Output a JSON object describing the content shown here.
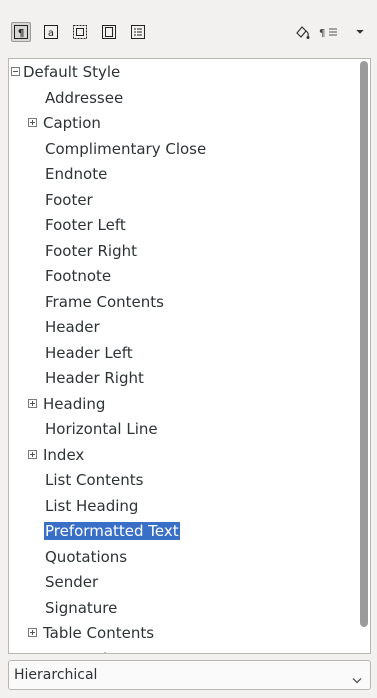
{
  "toolbar": {
    "icons": [
      "paragraph-styles-icon",
      "character-styles-icon",
      "frame-styles-icon",
      "page-styles-icon",
      "list-styles-icon",
      "fill-format-mode-icon",
      "new-style-icon",
      "dropdown-arrow-icon"
    ]
  },
  "tree": {
    "items": [
      {
        "label": "Default Style",
        "expander": "minus"
      },
      {
        "label": "Addressee"
      },
      {
        "label": "Caption",
        "expander": "plus"
      },
      {
        "label": "Complimentary Close"
      },
      {
        "label": "Endnote"
      },
      {
        "label": "Footer"
      },
      {
        "label": "Footer Left"
      },
      {
        "label": "Footer Right"
      },
      {
        "label": "Footnote"
      },
      {
        "label": "Frame Contents"
      },
      {
        "label": "Header"
      },
      {
        "label": "Header Left"
      },
      {
        "label": "Header Right"
      },
      {
        "label": "Heading",
        "expander": "plus"
      },
      {
        "label": "Horizontal Line"
      },
      {
        "label": "Index",
        "expander": "plus"
      },
      {
        "label": "List Contents"
      },
      {
        "label": "List Heading"
      },
      {
        "label": "Preformatted Text",
        "selected": true
      },
      {
        "label": "Quotations"
      },
      {
        "label": "Sender"
      },
      {
        "label": "Signature"
      },
      {
        "label": "Table Contents",
        "expander": "plus"
      },
      {
        "label": "Text Body",
        "expander": "plus"
      }
    ]
  },
  "filter": {
    "value": "Hierarchical"
  },
  "colors": {
    "selection": "#3a6fc8",
    "panel_bg": "#ffffff",
    "window_bg": "#f2f1f0"
  }
}
